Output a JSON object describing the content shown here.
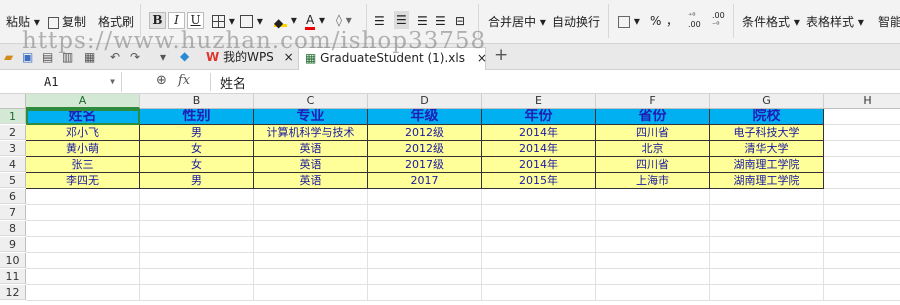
{
  "ribbon": {
    "paste": "粘贴",
    "copy": "复制",
    "format_painter": "格式刷",
    "bold": "B",
    "italic": "I",
    "underline": "U",
    "font_color": "A",
    "merge_center": "合并居中",
    "wrap_text": "自动换行",
    "percent": "%",
    "comma": "，",
    "conditional_format": "条件格式",
    "table_style": "表格样式",
    "smart": "智能"
  },
  "tabs": {
    "mywps": "我的WPS",
    "file": "GraduateStudent (1).xls",
    "close": "×",
    "new": "+"
  },
  "watermark": "https://www.huzhan.com/ishop33758",
  "formula_bar": {
    "cell_ref": "A1",
    "fx": "fx",
    "value": "姓名"
  },
  "grid": {
    "columns": [
      "A",
      "B",
      "C",
      "D",
      "E",
      "F",
      "G",
      "H"
    ],
    "rows": [
      "1",
      "2",
      "3",
      "4",
      "5",
      "6",
      "7",
      "8",
      "9",
      "10",
      "11",
      "12"
    ],
    "header": [
      "姓名",
      "性别",
      "专业",
      "年级",
      "年份",
      "省份",
      "院校"
    ],
    "data": [
      [
        "邓小飞",
        "男",
        "计算机科学与技术",
        "2012级",
        "2014年",
        "四川省",
        "电子科技大学"
      ],
      [
        "黄小萌",
        "女",
        "英语",
        "2012级",
        "2014年",
        "北京",
        "清华大学"
      ],
      [
        "张三",
        "女",
        "英语",
        "2017级",
        "2014年",
        "四川省",
        "湖南理工学院"
      ],
      [
        "李四无",
        "男",
        "英语",
        "2017",
        "2015年",
        "上海市",
        "湖南理工学院"
      ]
    ]
  },
  "colors": {
    "header_fill": "#00b0f0",
    "data_fill": "#ffff99",
    "selection": "#2e8b3e",
    "text": "#1a1aa0"
  }
}
